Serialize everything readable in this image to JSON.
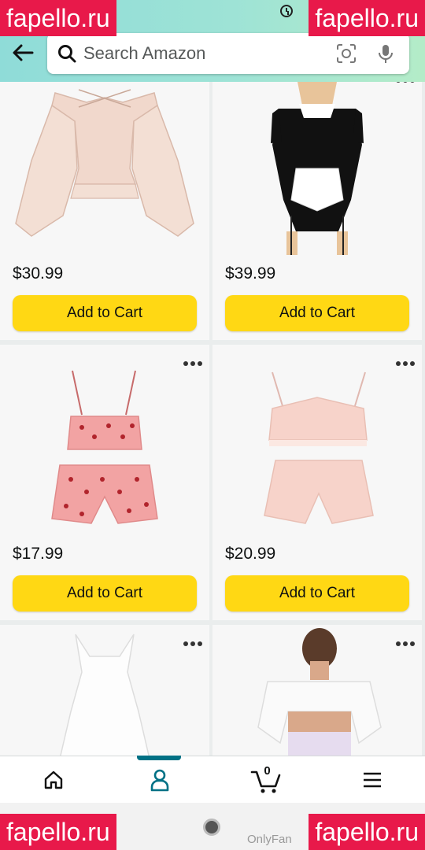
{
  "search": {
    "placeholder": "Search Amazon"
  },
  "products": [
    {
      "price": "$30.99",
      "button_label": "Add to Cart",
      "image": "ruffled-blouse"
    },
    {
      "price": "$39.99",
      "button_label": "Add to Cart",
      "image": "maid-costume"
    },
    {
      "price": "$17.99",
      "button_label": "Add to Cart",
      "image": "strawberry-pajama-set"
    },
    {
      "price": "$20.99",
      "button_label": "Add to Cart",
      "image": "pink-lace-lingerie-set"
    },
    {
      "price": "",
      "button_label": "",
      "image": "white-dress"
    },
    {
      "price": "",
      "button_label": "",
      "image": "off-shoulder-top"
    }
  ],
  "bottom_nav": {
    "items": [
      "home-icon",
      "account-icon",
      "cart-icon",
      "menu-icon"
    ],
    "cart_count": "0"
  },
  "system": {
    "overlay_text": "OnlyFan"
  },
  "watermarks": {
    "text": "fapello.ru"
  },
  "colors": {
    "accent_teal": "#007185",
    "button_yellow": "#ffd814",
    "watermark_red": "#e8194a"
  }
}
